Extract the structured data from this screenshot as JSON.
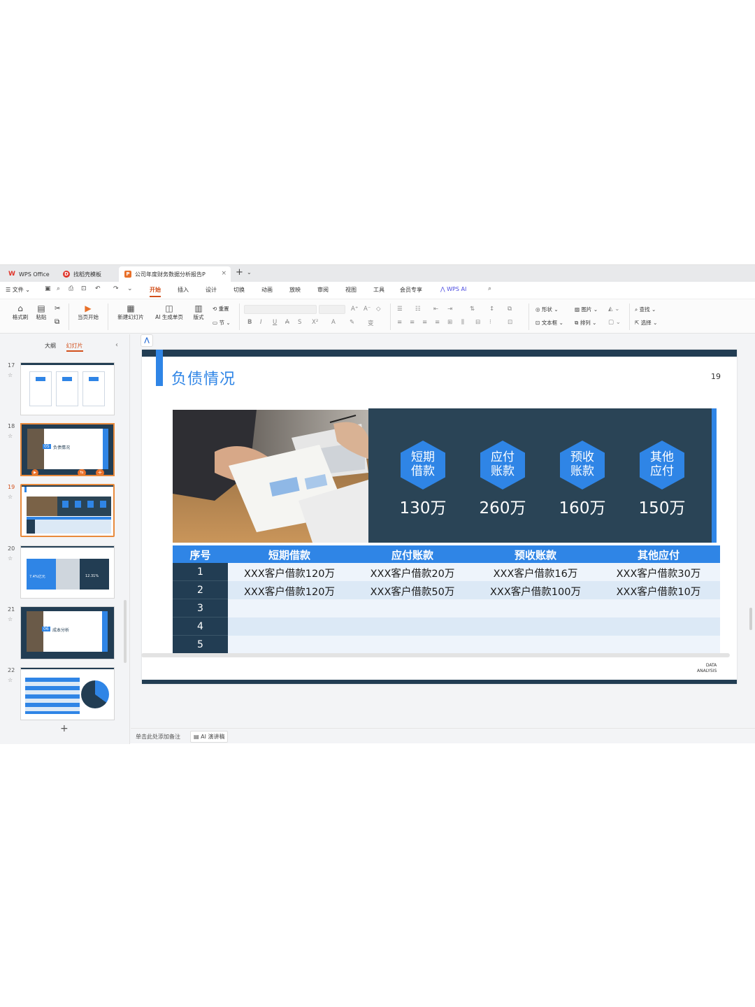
{
  "tabs": [
    {
      "label": "WPS Office",
      "icon": "wps-logo-icon",
      "color": "#e0352b"
    },
    {
      "label": "找稻壳模板",
      "icon": "docer-icon",
      "color": "#e0352b"
    },
    {
      "label": "公司年度财务数据分析报告P",
      "icon": "ppt-file-icon",
      "color": "#e8702a"
    }
  ],
  "menu": {
    "file": "文件",
    "items": [
      "开始",
      "插入",
      "设计",
      "切换",
      "动画",
      "放映",
      "审阅",
      "视图",
      "工具",
      "会员专享"
    ],
    "active": "开始",
    "wps_ai": "WPS AI"
  },
  "ribbon": {
    "format_painter": "格式刷",
    "paste": "粘贴",
    "from_current": "当页开始",
    "new_slide": "新建幻灯片",
    "ai_generate": "AI 生成单页",
    "layout": "版式",
    "reset": "重置",
    "section": "节",
    "shape": "形状",
    "picture": "图片",
    "textbox": "文本框",
    "arrange": "排列",
    "find": "查找",
    "select": "选择"
  },
  "left_panel": {
    "tab_outline": "大纲",
    "tab_slides": "幻灯片",
    "slide_numbers": [
      "17",
      "18",
      "19",
      "20",
      "21",
      "22"
    ],
    "selected": "19",
    "thumb18_title": "负债情况",
    "thumb18_num": "05",
    "thumb21_title": "成本分析",
    "thumb21_num": "06",
    "thumb20_value": "12.31%",
    "thumb20_value2": "7.4%亿元"
  },
  "slide": {
    "title": "负债情况",
    "number": "19",
    "data_tag_line1": "DATA",
    "data_tag_line2": "ANALYSIS",
    "stats": [
      {
        "label_line1": "短期",
        "label_line2": "借款",
        "value": "130万"
      },
      {
        "label_line1": "应付",
        "label_line2": "账款",
        "value": "260万"
      },
      {
        "label_line1": "预收",
        "label_line2": "账款",
        "value": "160万"
      },
      {
        "label_line1": "其他",
        "label_line2": "应付",
        "value": "150万"
      }
    ],
    "table": {
      "headers": [
        "序号",
        "短期借款",
        "应付账款",
        "预收账款",
        "其他应付"
      ],
      "rows": [
        [
          "1",
          "XXX客户借款120万",
          "XXX客户借款20万",
          "XXX客户借款16万",
          "XXX客户借款30万"
        ],
        [
          "2",
          "XXX客户借款120万",
          "XXX客户借款50万",
          "XXX客户借款100万",
          "XXX客户借款10万"
        ],
        [
          "3",
          "",
          "",
          "",
          ""
        ],
        [
          "4",
          "",
          "",
          "",
          ""
        ],
        [
          "5",
          "",
          "",
          "",
          ""
        ]
      ]
    }
  },
  "status": {
    "note_hint": "单击此处添加备注",
    "ai_notes": "AI 演讲稿"
  },
  "colors": {
    "accent": "#2f85e6",
    "navy": "#223d53",
    "panel": "#2a4456",
    "active_menu": "#d2501c"
  }
}
